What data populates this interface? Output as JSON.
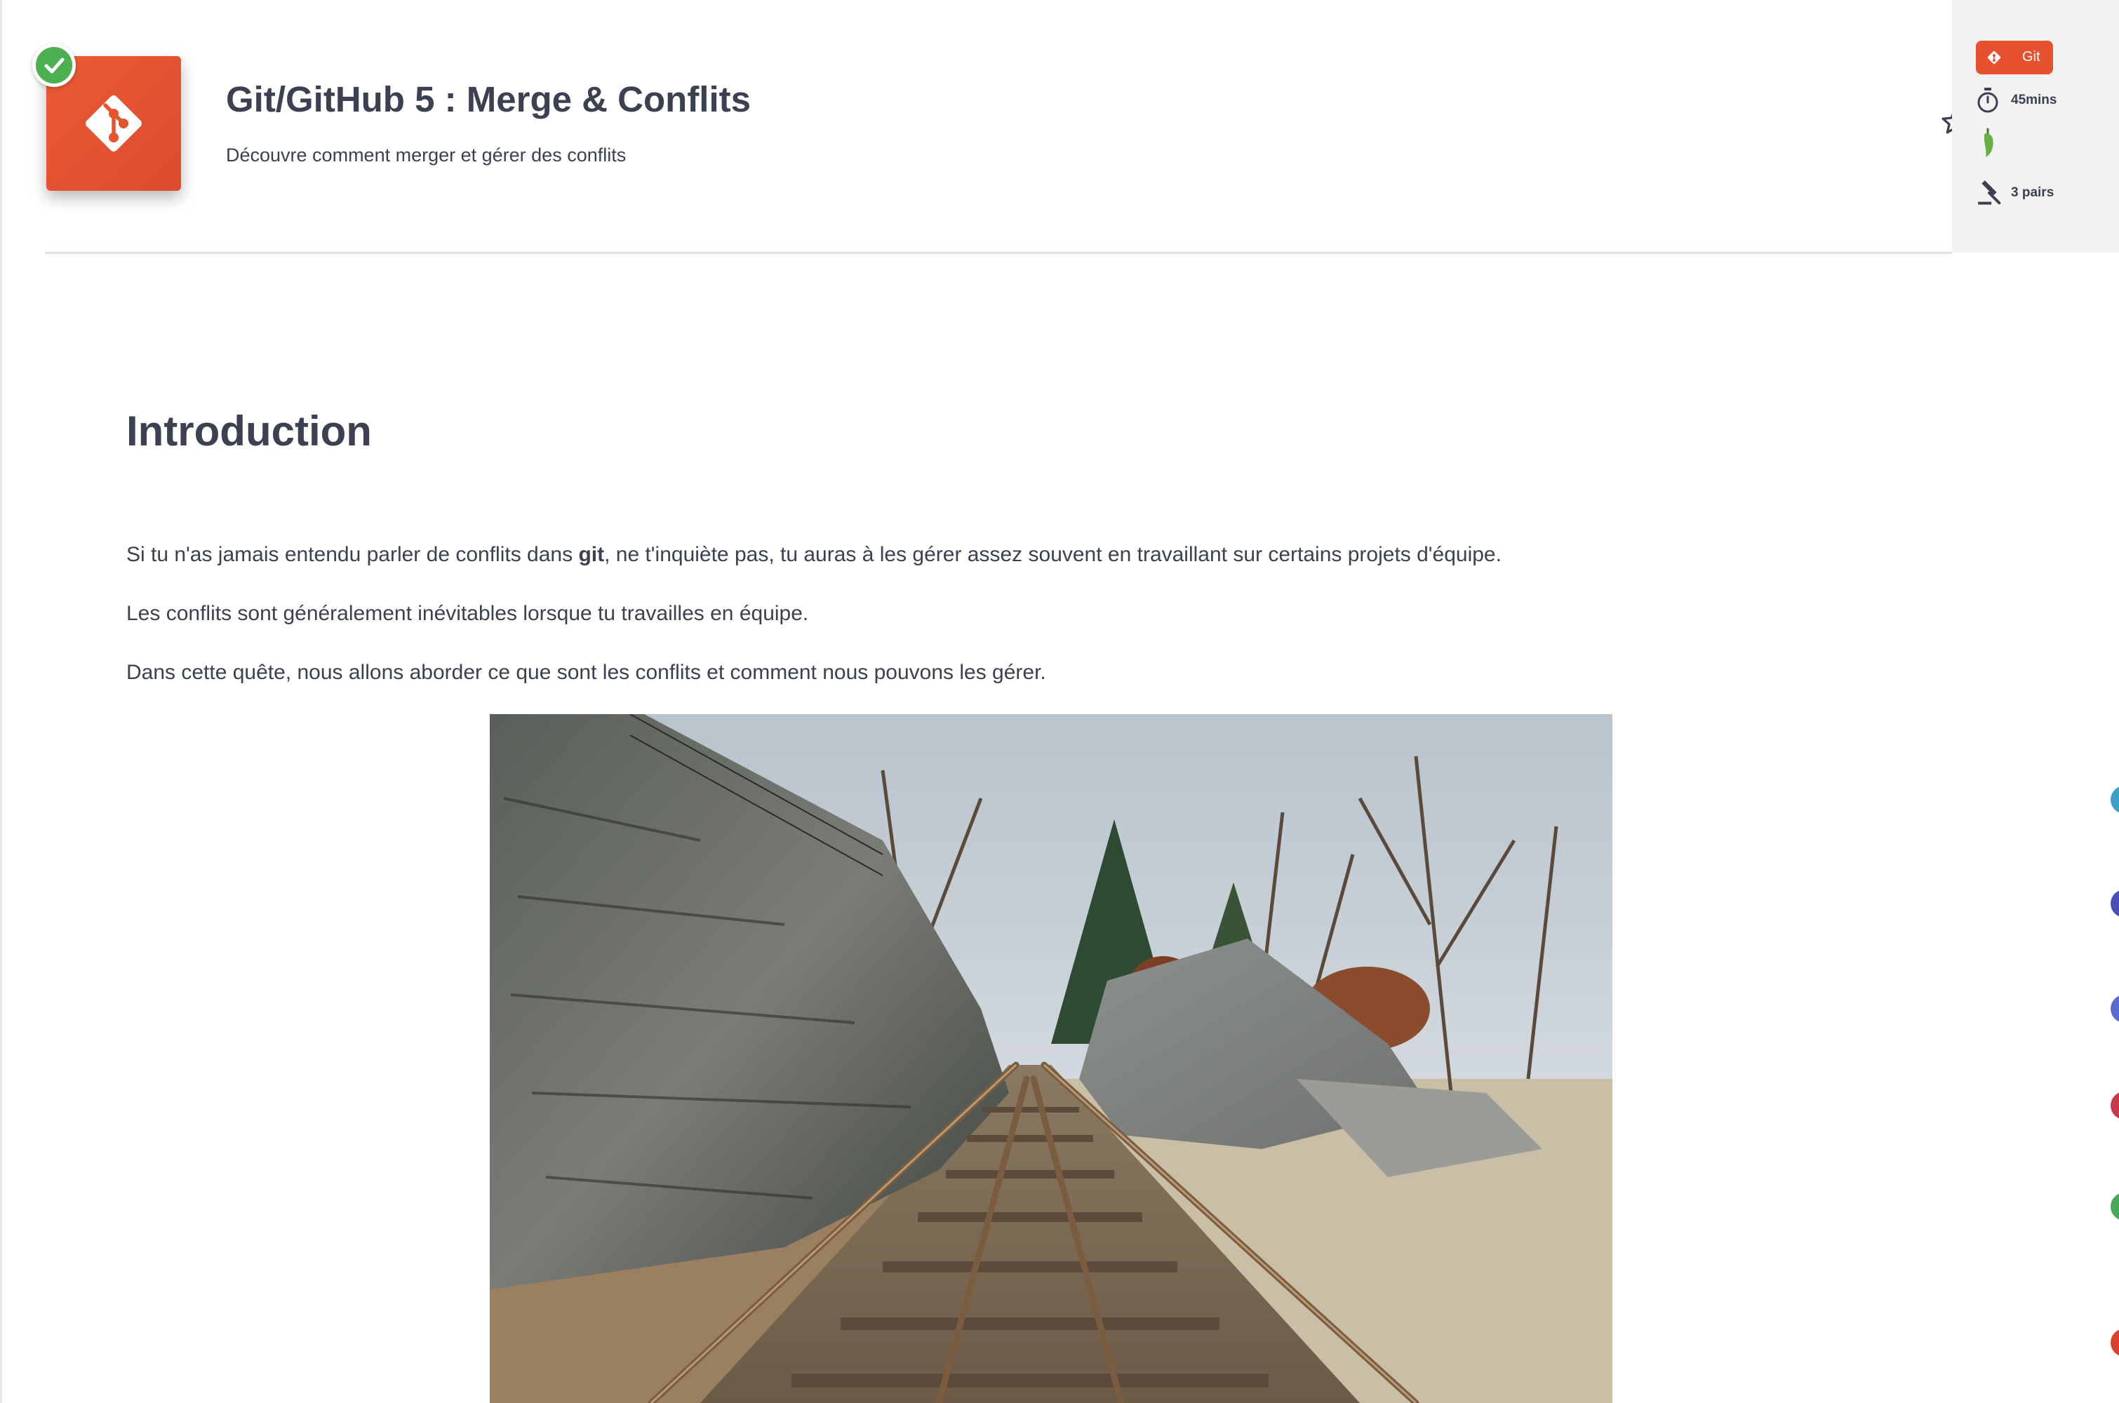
{
  "header": {
    "title": "Git/GitHub 5 : Merge & Conflits",
    "subtitle": "Découvre comment merger et gérer des conflits",
    "icon": "git-logo-icon",
    "completed_icon": "check-circle-icon",
    "favorite_icon": "star-outline-icon"
  },
  "info": {
    "tag": "Git",
    "duration": "45mins",
    "difficulty_icon": "pepper-icon",
    "evaluation": "3 pairs"
  },
  "content": {
    "heading": "Introduction",
    "p1_before": "Si tu n'as jamais entendu parler de conflits dans ",
    "p1_bold": "git",
    "p1_after": ", ne t'inquiète pas, tu auras à les gérer assez souvent en travaillant sur certains projets d'équipe.",
    "p2": "Les conflits sont généralement inévitables lorsque tu travailles en équipe.",
    "p3": "Dans cette quête, nous allons aborder ce que sont les conflits et comment nous pouvons les gérer.",
    "image": "railroad-tracks-merging-photo"
  },
  "colors": {
    "accent": "#e8512f",
    "success": "#4caf50",
    "text": "#3b4150",
    "panel": "#f2f2f2"
  }
}
